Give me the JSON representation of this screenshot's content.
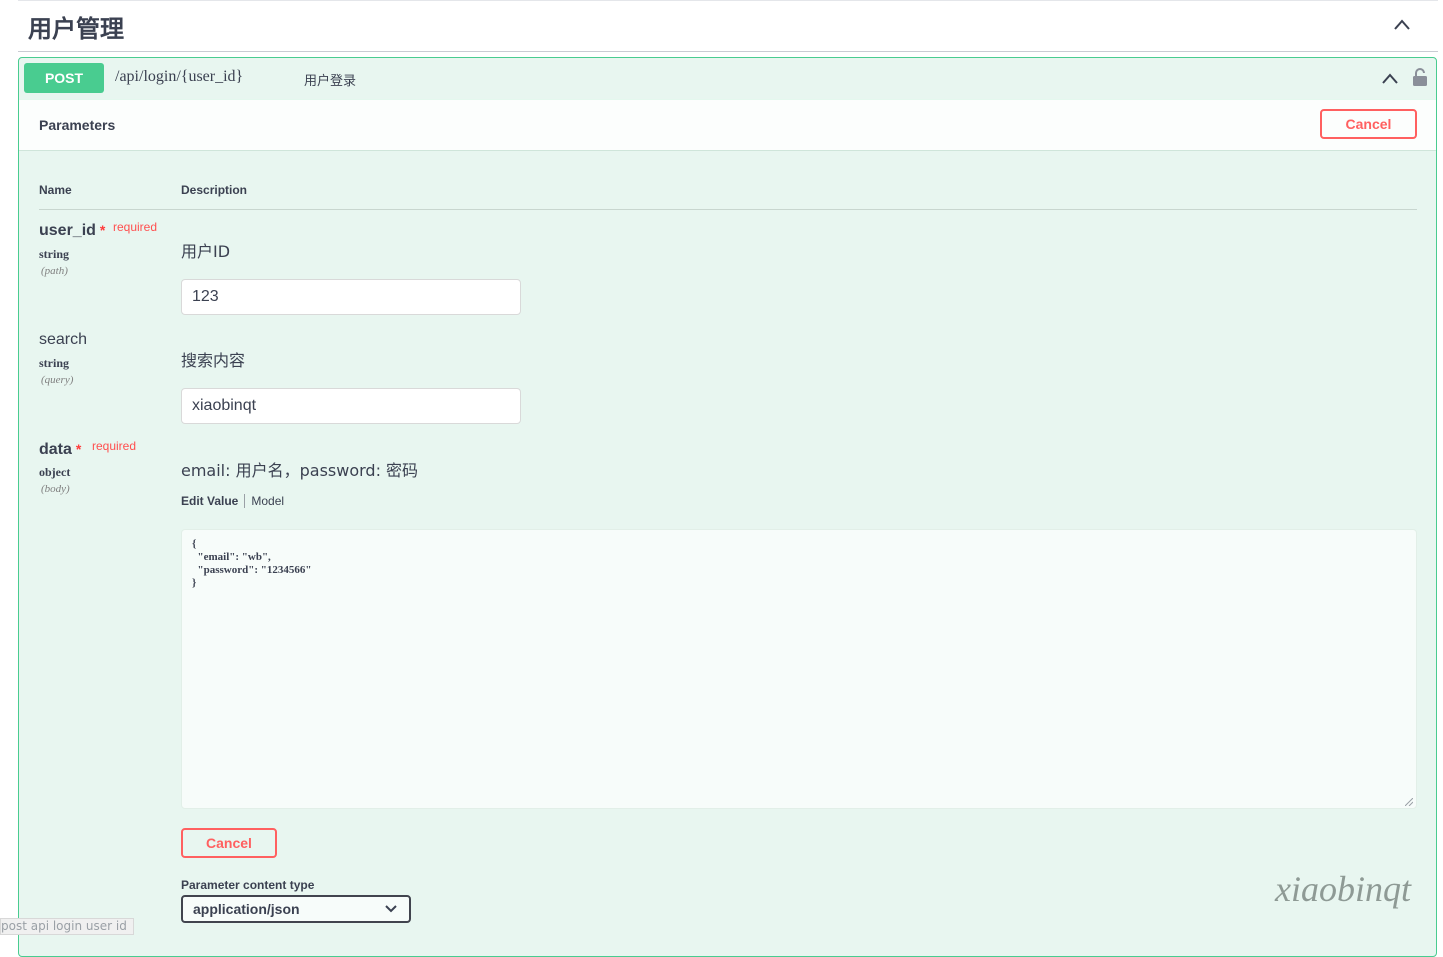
{
  "section": {
    "title": "用户管理"
  },
  "operation": {
    "method": "POST",
    "path": "/api/login/{user_id}",
    "summary": "用户登录"
  },
  "parameters_panel": {
    "title": "Parameters",
    "cancel_label": "Cancel",
    "column_name": "Name",
    "column_description": "Description"
  },
  "params": [
    {
      "name": "user_id",
      "required_label": "required",
      "star": "*",
      "type": "string",
      "in": "(path)",
      "description": "用户ID",
      "value": "123"
    },
    {
      "name": "search",
      "type": "string",
      "in": "(query)",
      "description": "搜索内容",
      "value": "xiaobinqt"
    },
    {
      "name": "data",
      "required_label": "required",
      "star": "*",
      "type": "object",
      "in": "(body)",
      "description": "email: 用户名，password: 密码"
    }
  ],
  "body_tabs": {
    "edit_value": "Edit Value",
    "model": "Model"
  },
  "body_json": "{\n  \"email\": \"wb\",\n  \"password\": \"1234566\"\n}",
  "body_cancel_label": "Cancel",
  "content_type": {
    "label": "Parameter content type",
    "selected": "application/json"
  },
  "watermark": "xiaobinqt",
  "status_bar": {
    "text": "post api login user id"
  },
  "colors": {
    "post": "#49cc90",
    "post_bg": "#e8f6f0",
    "cancel": "#ff6060",
    "required": "#ff4f4f"
  }
}
